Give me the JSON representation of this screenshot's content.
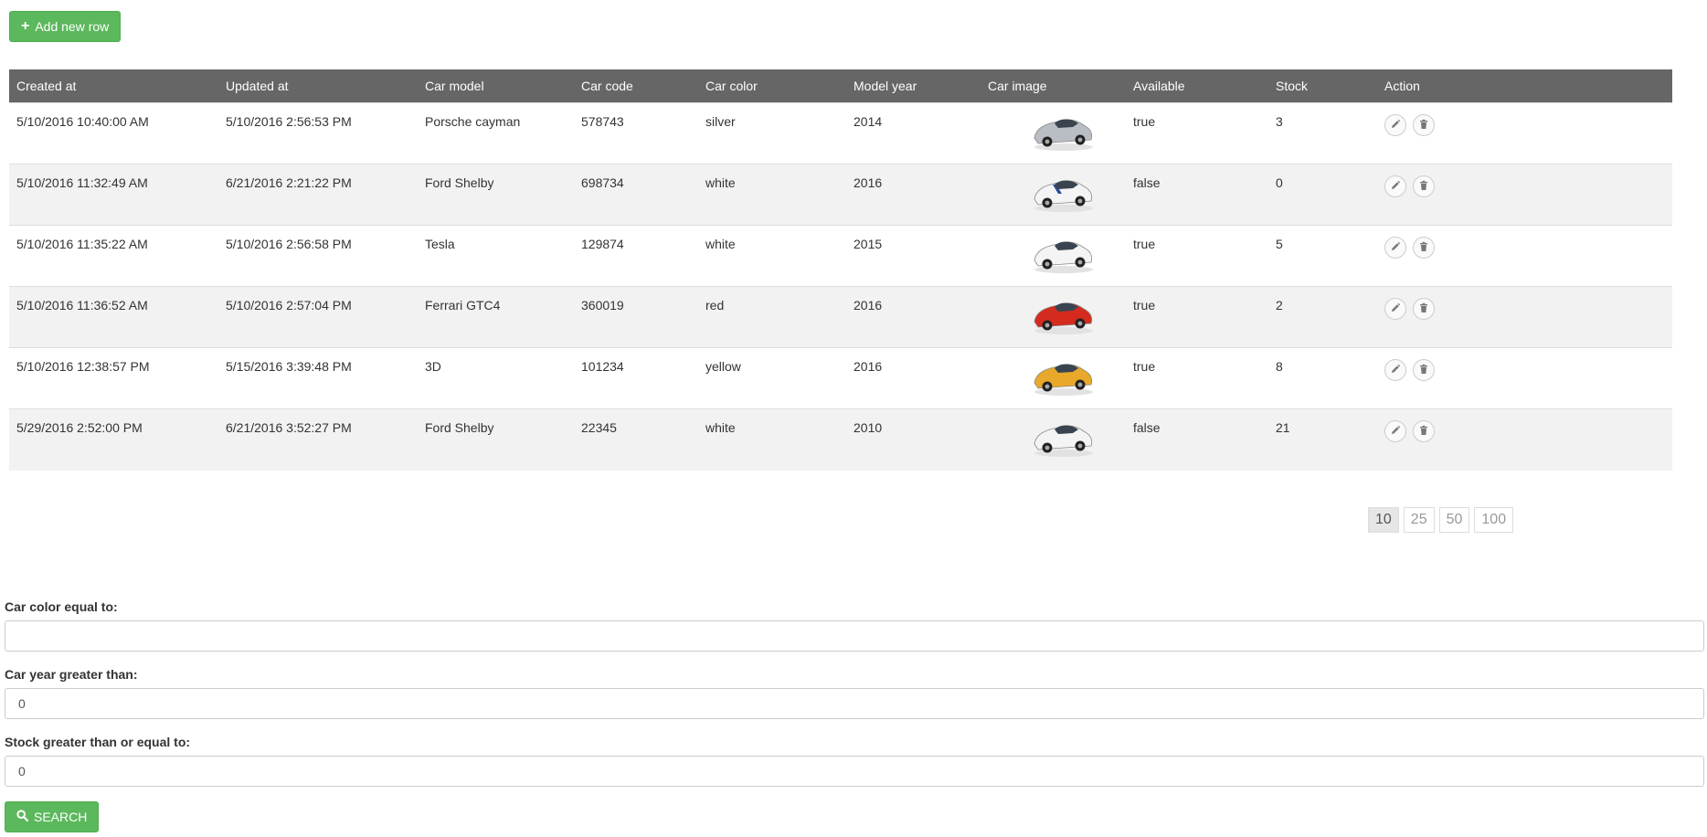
{
  "toolbar": {
    "add_label": "Add new row"
  },
  "table": {
    "headers": [
      "Created at",
      "Updated at",
      "Car model",
      "Car code",
      "Car color",
      "Model year",
      "Car image",
      "Available",
      "Stock",
      "Action"
    ],
    "rows": [
      {
        "created": "5/10/2016 10:40:00 AM",
        "updated": "5/10/2016 2:56:53 PM",
        "model": "Porsche cayman",
        "code": "578743",
        "color": "silver",
        "year": "2014",
        "available": "true",
        "stock": "3"
      },
      {
        "created": "5/10/2016 11:32:49 AM",
        "updated": "6/21/2016 2:21:22 PM",
        "model": "Ford Shelby",
        "code": "698734",
        "color": "white",
        "year": "2016",
        "available": "false",
        "stock": "0"
      },
      {
        "created": "5/10/2016 11:35:22 AM",
        "updated": "5/10/2016 2:56:58 PM",
        "model": "Tesla",
        "code": "129874",
        "color": "white",
        "year": "2015",
        "available": "true",
        "stock": "5"
      },
      {
        "created": "5/10/2016 11:36:52 AM",
        "updated": "5/10/2016 2:57:04 PM",
        "model": "Ferrari GTC4",
        "code": "360019",
        "color": "red",
        "year": "2016",
        "available": "true",
        "stock": "2"
      },
      {
        "created": "5/10/2016 12:38:57 PM",
        "updated": "5/15/2016 3:39:48 PM",
        "model": "3D",
        "code": "101234",
        "color": "yellow",
        "year": "2016",
        "available": "true",
        "stock": "8"
      },
      {
        "created": "5/29/2016 2:52:00 PM",
        "updated": "6/21/2016 3:52:27 PM",
        "model": "Ford Shelby",
        "code": "22345",
        "color": "white",
        "year": "2010",
        "available": "false",
        "stock": "21"
      }
    ]
  },
  "pagination": {
    "sizes": [
      "10",
      "25",
      "50",
      "100"
    ],
    "active": "10"
  },
  "filters": {
    "color_label": "Car color equal to:",
    "color_value": "",
    "year_label": "Car year greater than:",
    "year_value": "0",
    "stock_label": "Stock greater than or equal to:",
    "stock_value": "0"
  },
  "search": {
    "label": "SEARCH"
  },
  "colors": {
    "accent": "#5cb85c",
    "header_bg": "#666666",
    "stripe": "#f2f2f2"
  },
  "icons": {
    "add": "plus-icon",
    "edit": "pencil-icon",
    "delete": "trash-icon",
    "search": "search-icon"
  }
}
